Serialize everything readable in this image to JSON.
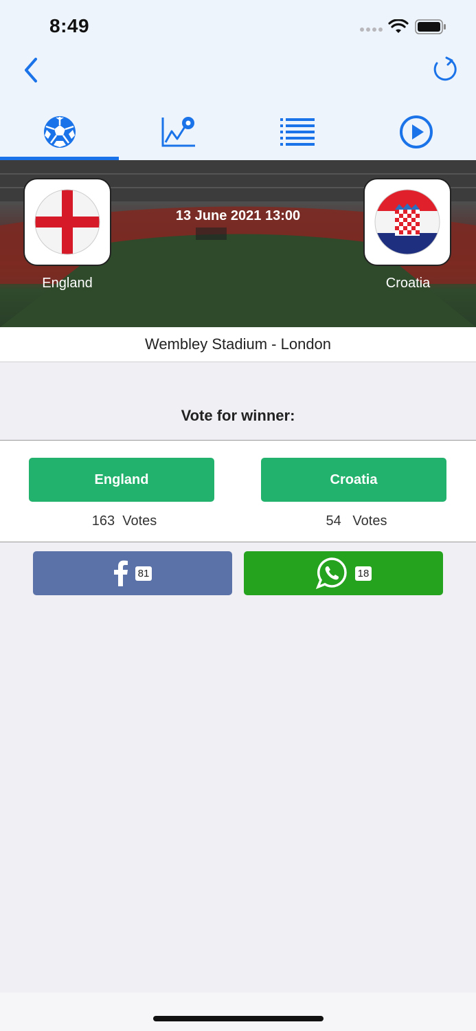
{
  "status_bar": {
    "time": "8:49"
  },
  "tabs": [
    {
      "icon": "soccer-ball-icon",
      "active": true
    },
    {
      "icon": "stats-chart-icon",
      "active": false
    },
    {
      "icon": "list-icon",
      "active": false
    },
    {
      "icon": "play-icon",
      "active": false
    }
  ],
  "match": {
    "home_team": "England",
    "away_team": "Croatia",
    "datetime": "13 June 2021 13:00",
    "venue": "Wembley Stadium - London"
  },
  "vote": {
    "title": "Vote for winner:",
    "home_label": "England",
    "away_label": "Croatia",
    "home_votes": "163  Votes",
    "away_votes": "54   Votes"
  },
  "share": {
    "facebook_count": "81",
    "whatsapp_count": "18"
  },
  "colors": {
    "accent": "#1a73e8",
    "vote_green": "#23b26d",
    "facebook_blue": "#5a72a8",
    "whatsapp_green": "#25a31e"
  }
}
